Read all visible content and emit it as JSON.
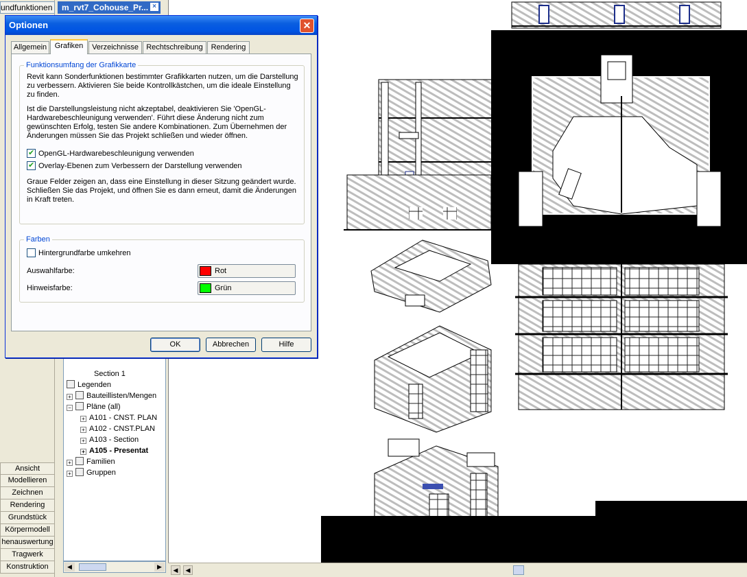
{
  "designbar": {
    "top_label": "undfunktionen",
    "tabs": [
      "Ansicht",
      "Modellieren",
      "Zeichnen",
      "Rendering",
      "Grundstück",
      "Körpermodell",
      "henauswertung",
      "Tragwerk",
      "Konstruktion"
    ]
  },
  "doc_tab": {
    "label": "m_rvt7_Cohouse_Pr...",
    "close": "×"
  },
  "tree": {
    "rows": [
      {
        "label": "Section 1",
        "indent": 3,
        "marker": "",
        "bold": false
      },
      {
        "label": "Legenden",
        "indent": 1,
        "marker": "",
        "bold": false
      },
      {
        "label": "Bauteillisten/Mengen",
        "indent": 1,
        "marker": "+",
        "bold": false
      },
      {
        "label": "Pläne (all)",
        "indent": 1,
        "marker": "−",
        "bold": false
      },
      {
        "label": "A101 - CNST. PLAN",
        "indent": 2,
        "marker": "+",
        "bold": false
      },
      {
        "label": "A102 - CNST.PLAN",
        "indent": 2,
        "marker": "+",
        "bold": false
      },
      {
        "label": "A103 - Section",
        "indent": 2,
        "marker": "+",
        "bold": false
      },
      {
        "label": "A105 - Presentat",
        "indent": 2,
        "marker": "+",
        "bold": true
      },
      {
        "label": "Familien",
        "indent": 1,
        "marker": "+",
        "bold": false
      },
      {
        "label": "Gruppen",
        "indent": 1,
        "marker": "+",
        "bold": false
      }
    ]
  },
  "dialog": {
    "title": "Optionen",
    "close": "✕",
    "tabs": [
      "Allgemein",
      "Grafiken",
      "Verzeichnisse",
      "Rechtschreibung",
      "Rendering"
    ],
    "active_tab": "Grafiken",
    "gpu_group": {
      "legend": "Funktionsumfang der Grafikkarte",
      "para1": "Revit kann Sonderfunktionen bestimmter Grafikkarten nutzen, um die Darstellung zu verbessern. Aktivieren Sie beide Kontrollkästchen, um die ideale Einstellung zu finden.",
      "para2": "Ist die Darstellungsleistung nicht akzeptabel, deaktivieren Sie 'OpenGL-Hardwarebeschleunigung verwenden'. Führt diese Änderung nicht zum gewünschten Erfolg, testen Sie andere Kombinationen. Zum Übernehmen der Änderungen müssen Sie das Projekt schließen und wieder öffnen.",
      "check1_label": "OpenGL-Hardwarebeschleunigung verwenden",
      "check1_checked": true,
      "check2_label": "Overlay-Ebenen zum Verbessern der Darstellung verwenden",
      "check2_checked": true,
      "para3": "Graue Felder zeigen an, dass eine Einstellung in dieser Sitzung geändert wurde. Schließen Sie das Projekt, und öffnen Sie es dann erneut, damit die Änderungen in Kraft treten."
    },
    "colors_group": {
      "legend": "Farben",
      "invert_label": "Hintergrundfarbe umkehren",
      "invert_checked": false,
      "selection_label": "Auswahlfarbe:",
      "selection_value": "Rot",
      "selection_color": "#ff0000",
      "hint_label": "Hinweisfarbe:",
      "hint_value": "Grün",
      "hint_color": "#00ff00"
    },
    "buttons": {
      "ok": "OK",
      "cancel": "Abbrechen",
      "help": "Hilfe"
    }
  },
  "colors": {
    "accent": "#0054e3",
    "tab_highlight": "#ffc83c"
  }
}
